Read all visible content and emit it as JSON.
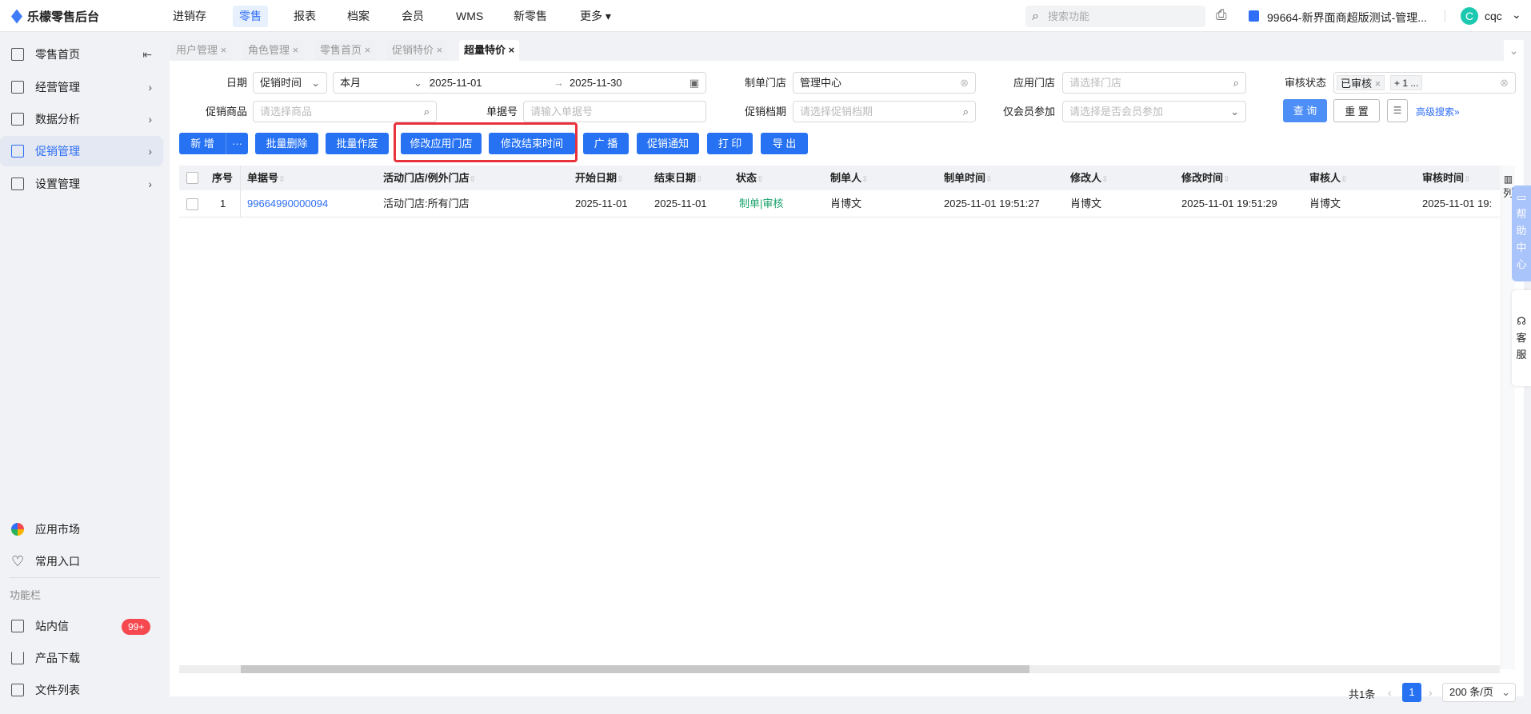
{
  "app": {
    "title": "乐檬零售后台"
  },
  "topnav": [
    "进销存",
    "零售",
    "报表",
    "档案",
    "会员",
    "WMS",
    "新零售",
    "更多"
  ],
  "search_placeholder": "搜索功能",
  "store": "99664-新界面商超版测试-管理...",
  "user": {
    "initial": "C",
    "name": "cqc"
  },
  "sidebar": {
    "items": [
      "零售首页",
      "经营管理",
      "数据分析",
      "促销管理",
      "设置管理"
    ],
    "bottom": [
      "应用市场",
      "常用入口"
    ],
    "section": "功能栏",
    "tools": [
      "站内信",
      "产品下载",
      "文件列表"
    ],
    "badge": "99+"
  },
  "tabs": [
    "用户管理",
    "角色管理",
    "零售首页",
    "促销特价",
    "超量特价"
  ],
  "filters": {
    "date_label": "日期",
    "date_type": "促销时间",
    "period": "本月",
    "start": "2025-11-01",
    "end": "2025-11-30",
    "arrow": "→",
    "maker_store_label": "制单门店",
    "maker_store": "管理中心",
    "apply_store_label": "应用门店",
    "apply_store_ph": "请选择门店",
    "audit_label": "审核状态",
    "audit_tag": "已审核",
    "audit_more": "+ 1 ...",
    "goods_label": "促销商品",
    "goods_ph": "请选择商品",
    "bill_label": "单据号",
    "bill_ph": "请输入单据号",
    "schedule_label": "促销档期",
    "schedule_ph": "请选择促销档期",
    "member_label": "仅会员参加",
    "member_ph": "请选择是否会员参加",
    "query": "查 询",
    "reset": "重 置",
    "advanced": "高级搜索"
  },
  "toolbar": [
    "新 增",
    "批量删除",
    "批量作废",
    "修改应用门店",
    "修改结束时间",
    "广 播",
    "促销通知",
    "打 印",
    "导 出"
  ],
  "more": "···",
  "table": {
    "headers": [
      "序号",
      "单据号",
      "活动门店/例外门店",
      "开始日期",
      "结束日期",
      "状态",
      "制单人",
      "制单时间",
      "修改人",
      "修改时间",
      "审核人",
      "审核时间"
    ],
    "rows": [
      [
        "1",
        "99664990000094",
        "活动门店:所有门店",
        "2025-11-01",
        "2025-11-01",
        "制单|审核",
        "肖博文",
        "2025-11-01 19:51:27",
        "肖博文",
        "2025-11-01 19:51:29",
        "肖博文",
        "2025-11-01 19:"
      ]
    ],
    "columns_label": "列"
  },
  "pagination": {
    "total": "共1条",
    "page": "1",
    "size": "200 条/页"
  },
  "float": {
    "help": [
      "帮",
      "助",
      "中",
      "心"
    ],
    "service": [
      "客",
      "服"
    ]
  },
  "colors": {
    "primary": "#2672f3",
    "highlight": "#e8323c",
    "status": "#1aa36b"
  }
}
